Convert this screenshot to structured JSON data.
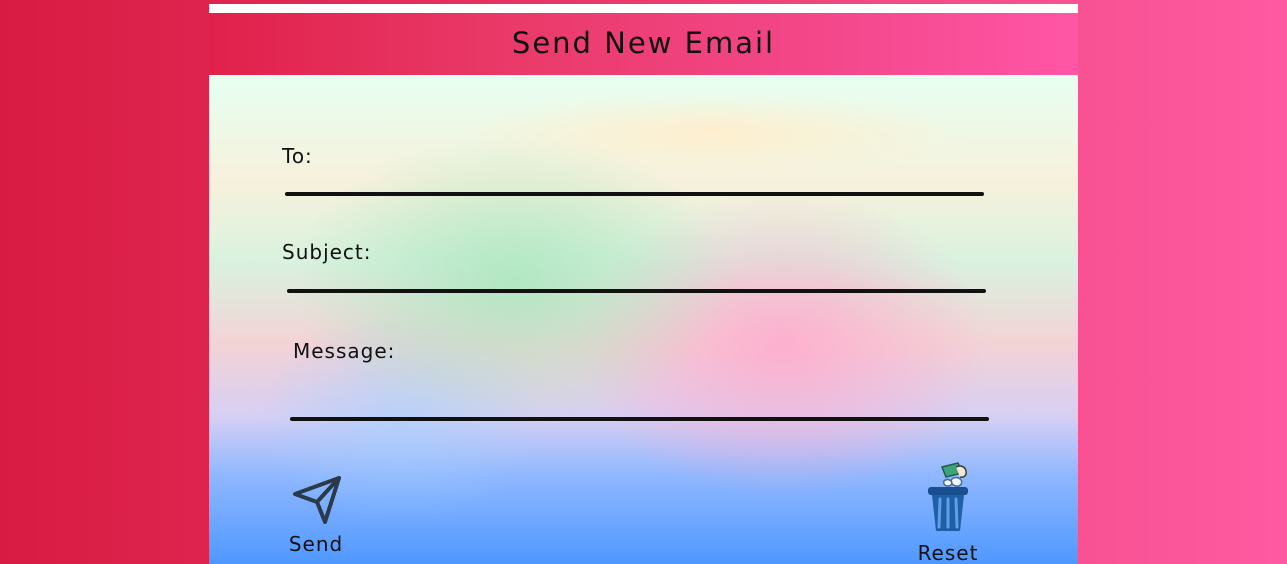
{
  "header": {
    "title": "Send New Email"
  },
  "form": {
    "to_label": "To:",
    "subject_label": "Subject:",
    "message_label": "Message:"
  },
  "actions": {
    "send_label": "Send",
    "reset_label": "Reset"
  },
  "icons": {
    "send": "paper-plane-icon",
    "reset": "trash-bin-icon"
  },
  "colors": {
    "background_left": "#d81b42",
    "background_right": "#ff5aa2",
    "header_left": "#e0214b",
    "header_right": "#ff56a6",
    "ink": "#111111",
    "trash_blue": "#1f5fa8",
    "trash_lid": "#1a4f8f",
    "paper_green": "#3aa57a",
    "paper_white": "#f5f7ff"
  }
}
